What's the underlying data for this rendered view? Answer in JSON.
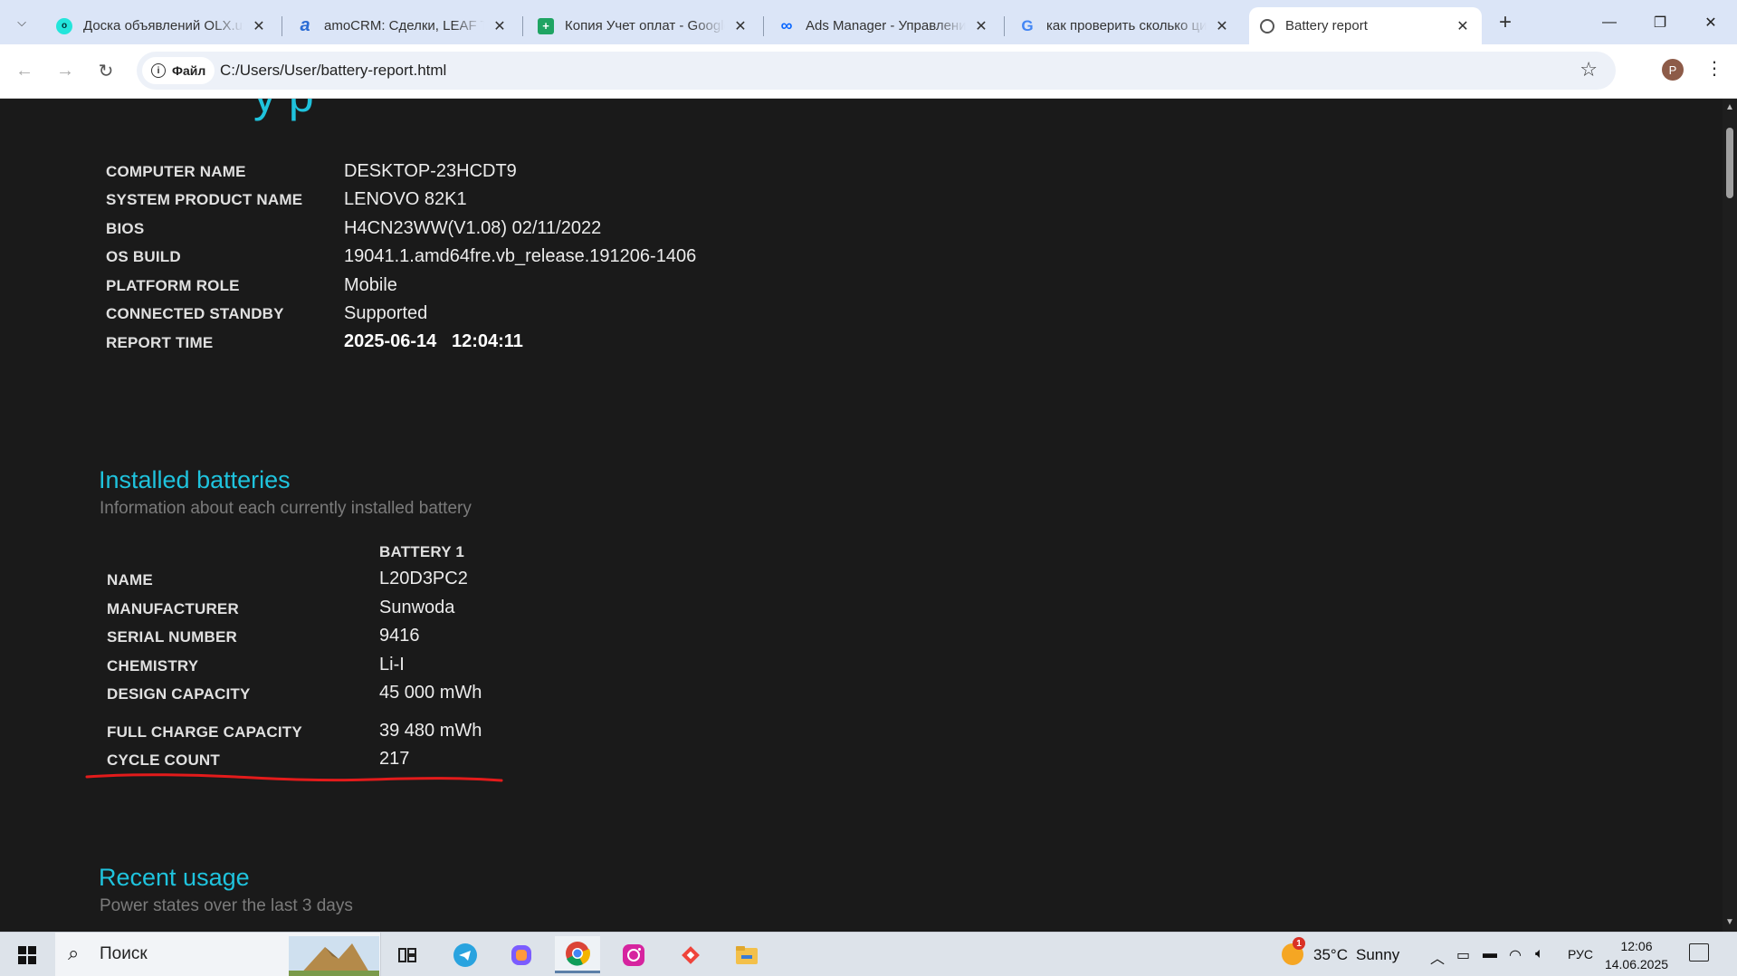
{
  "browser": {
    "tabs": [
      {
        "title": "Доска объявлений OLX.uz",
        "favicon": "olx-icon",
        "color": "#23e5db"
      },
      {
        "title": "amoCRM: Сделки, LEAF TR",
        "favicon": "amocrm-icon",
        "color": "#2b6cd4"
      },
      {
        "title": "Копия Учет оплат - Google",
        "favicon": "sheets-icon",
        "color": "#1fa463"
      },
      {
        "title": "Ads Manager - Управление",
        "favicon": "meta-icon",
        "color": "#0866ff"
      },
      {
        "title": "как проверить сколько ци",
        "favicon": "google-icon",
        "color": "#4285f4"
      },
      {
        "title": "Battery report",
        "favicon": "globe-icon",
        "color": "#555555"
      }
    ],
    "active_tab": 5,
    "address_chip": "Файл",
    "url": "C:/Users/User/battery-report.html",
    "profile_initial": "P"
  },
  "report": {
    "heading_fragment": "y  p",
    "system_info": [
      {
        "label": "COMPUTER NAME",
        "value": "DESKTOP-23HCDT9"
      },
      {
        "label": "SYSTEM PRODUCT NAME",
        "value": "LENOVO 82K1"
      },
      {
        "label": "BIOS",
        "value": "H4CN23WW(V1.08) 02/11/2022"
      },
      {
        "label": "OS BUILD",
        "value": "19041.1.amd64fre.vb_release.191206-1406"
      },
      {
        "label": "PLATFORM ROLE",
        "value": "Mobile"
      },
      {
        "label": "CONNECTED STANDBY",
        "value": "Supported"
      },
      {
        "label": "REPORT TIME",
        "value": "2025-06-14   12:04:11"
      }
    ],
    "installed_batteries": {
      "title": "Installed batteries",
      "subtitle": "Information about each currently installed battery",
      "column_header": "BATTERY 1",
      "rows": [
        {
          "label": "NAME",
          "value": "L20D3PC2"
        },
        {
          "label": "MANUFACTURER",
          "value": "Sunwoda"
        },
        {
          "label": "SERIAL NUMBER",
          "value": "9416"
        },
        {
          "label": "CHEMISTRY",
          "value": "Li-I"
        },
        {
          "label": "DESIGN CAPACITY",
          "value": "45 000 mWh"
        },
        {
          "label": "FULL CHARGE CAPACITY",
          "value": "39 480 mWh"
        },
        {
          "label": "CYCLE COUNT",
          "value": "217"
        }
      ]
    },
    "recent_usage": {
      "title": "Recent usage",
      "subtitle": "Power states over the last 3 days"
    },
    "annotation_color": "#e31b1b",
    "accent_color": "#1fc3dd"
  },
  "taskbar": {
    "search_placeholder": "Поиск",
    "weather": {
      "temp": "35°C",
      "condition": "Sunny",
      "badge": "1"
    },
    "language": "РУС",
    "time": "12:06",
    "date": "14.06.2025"
  }
}
